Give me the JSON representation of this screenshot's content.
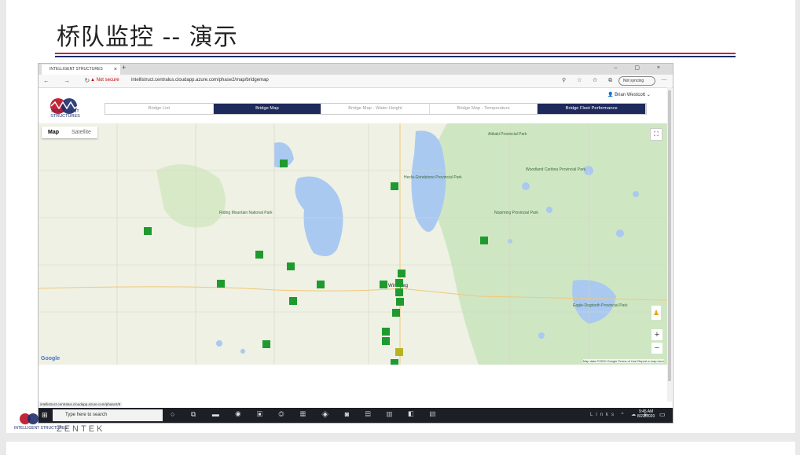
{
  "slide": {
    "title": "桥队监控 -- 演示",
    "footer_logo_text": "INTELLIGENT STRUCTURES",
    "footer_brand": "ZENTEK"
  },
  "browser": {
    "tab_title": "INTELLIGENT STRUCTURES",
    "tab_close": "×",
    "new_tab": "+",
    "window_controls": "–  ▢  ×",
    "nav_icons": "←  →  ↻",
    "security_label": "Not secure",
    "url": "intellistruct.centralus.cloudapp.azure.com/phase2/map/bridgemap",
    "address_icons": "⚲ ☆ ✩ ⧉",
    "sync_label": "Not syncing",
    "more_icon": "⋯",
    "status_url": "intellistruct.centralus.cloudapp.azure.com/phase2/9"
  },
  "app": {
    "logo_text": "INTELLIGENT STRUCTURES",
    "user": "👤 Brian Westcott ⌄",
    "nav_tabs": [
      {
        "label": "Bridge List",
        "active": false
      },
      {
        "label": "Bridge Map",
        "active": true
      },
      {
        "label": "Bridge Map - Water Height",
        "active": false
      },
      {
        "label": "Bridge Map - Temperature",
        "active": false
      },
      {
        "label": "Bridge Fleet Performance",
        "active": true
      }
    ]
  },
  "map": {
    "type_map": "Map",
    "type_satellite": "Satellite",
    "fullscreen_icon": "⛶",
    "pegman_icon": "♟",
    "zoom_in": "+",
    "zoom_out": "−",
    "google_logo": "Google",
    "attribution": "Map data ©2020 Google   Terms of Use   Report a map error",
    "places": [
      {
        "name": "Riding Mountain National Park"
      },
      {
        "name": "Hecla-Grindstone Provincial Park"
      },
      {
        "name": "Atikaki Provincial Park"
      },
      {
        "name": "Woodland Caribou Provincial Park"
      },
      {
        "name": "Nopiming Provincial Park"
      },
      {
        "name": "Eagle-Dogtooth Provincial Park"
      },
      {
        "name": "Winnipeg"
      }
    ],
    "colors": {
      "water": "#a9c9f0",
      "land": "#eef1e4",
      "forest": "#cfe6c3",
      "marker_green": "#1f9a2e",
      "marker_yellow": "#b8b322"
    }
  },
  "taskbar": {
    "start_icon": "⊞",
    "search_placeholder": "Type here to search",
    "app_icons": "○ ⧉ ▬ ◉ ▣ ◎ ▦ ◈ ◙ ▤ ▥ ◧ ▨",
    "tray": "Links ^ ☁ 🔈",
    "time": "9:45 AM",
    "date": "8/22/2020",
    "notification_icon": "▭"
  }
}
